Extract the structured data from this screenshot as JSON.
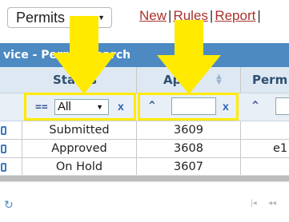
{
  "top": {
    "permits_select": "Permits",
    "links": {
      "new": "New",
      "rules": "Rules",
      "report": "Report",
      "sep": "|"
    }
  },
  "title": "vice - Permit Search",
  "columns": {
    "status": "Status",
    "app": "App",
    "perm": "Perm"
  },
  "filter": {
    "op_equals": "==",
    "status_value": "All",
    "op_caret": "^",
    "clear": "x"
  },
  "rows": [
    {
      "status": "Submitted",
      "app": "3609",
      "perm": ""
    },
    {
      "status": "Approved",
      "app": "3608",
      "perm": "e1"
    },
    {
      "status": "On Hold",
      "app": "3607",
      "perm": ""
    }
  ],
  "pager": {
    "first": "|◂",
    "prev": "◂◂"
  },
  "colors": {
    "accent": "#4d8ac2",
    "annotation": "#ffea00",
    "link": "#a8322d"
  }
}
